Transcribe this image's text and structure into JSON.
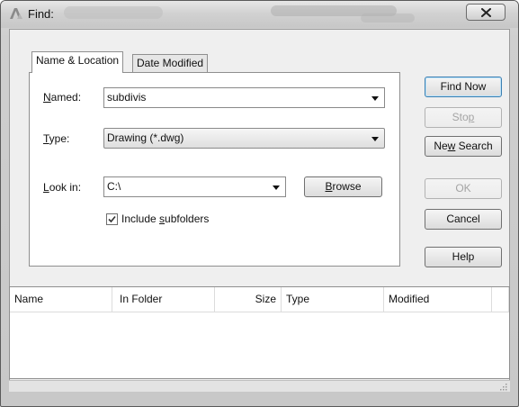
{
  "window": {
    "title": "Find:",
    "close_label": "X"
  },
  "tabs": [
    {
      "label": "Name & Location",
      "active": true
    },
    {
      "label": "Date Modified",
      "active": false
    }
  ],
  "form": {
    "named": {
      "label_prefix": "",
      "label_mnemonic": "N",
      "label_rest": "amed:",
      "value": "subdivis"
    },
    "type": {
      "label_prefix": "",
      "label_mnemonic": "T",
      "label_rest": "ype:",
      "value": "Drawing (*.dwg)"
    },
    "look_in": {
      "label_prefix": "",
      "label_mnemonic": "L",
      "label_rest": "ook in:",
      "value": "C:\\"
    },
    "browse": {
      "mnemonic": "B",
      "rest": "rowse"
    },
    "include_subfolders": {
      "prefix": "Include ",
      "mnemonic": "s",
      "rest": "ubfolders",
      "checked": true
    }
  },
  "buttons": {
    "find_now": "Find Now",
    "stop_prefix": "Sto",
    "stop_mnemonic": "p",
    "new_search_prefix": "Ne",
    "new_search_mnemonic": "w",
    "new_search_rest": " Search",
    "ok": "OK",
    "cancel": "Cancel",
    "help": "Help"
  },
  "results": {
    "columns": [
      "Name",
      "In Folder",
      "Size",
      "Type",
      "Modified"
    ],
    "rows": []
  }
}
